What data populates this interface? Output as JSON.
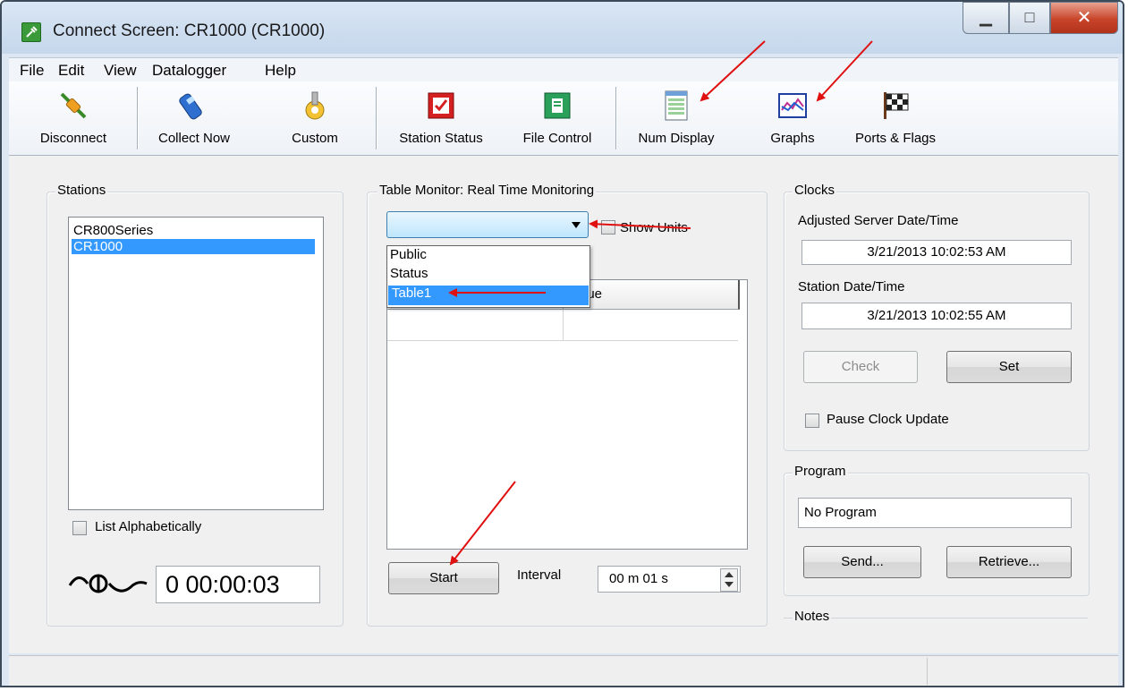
{
  "window": {
    "title": "Connect Screen: CR1000 (CR1000)"
  },
  "menu": [
    {
      "label": "File"
    },
    {
      "label": "Edit"
    },
    {
      "label": "View"
    },
    {
      "label": "Datalogger"
    },
    {
      "label": "Help"
    }
  ],
  "toolbar": {
    "disconnect": "Disconnect",
    "collect_now": "Collect Now",
    "custom": "Custom",
    "station_status": "Station Status",
    "file_control": "File Control",
    "num_display": "Num Display",
    "graphs": "Graphs",
    "ports_flags": "Ports & Flags"
  },
  "stations": {
    "label": "Stations",
    "items": [
      {
        "label": "CR800Series"
      },
      {
        "label": "CR1000"
      }
    ],
    "selected": "CR1000",
    "list_alpha": "List Alphabetically",
    "timer": "0 00:00:03"
  },
  "monitor": {
    "label": "Table Monitor: Real Time Monitoring",
    "show_units": "Show Units",
    "dropdown_options": [
      {
        "label": "Public"
      },
      {
        "label": "Status"
      },
      {
        "label": "Table1"
      }
    ],
    "highlighted_option": "Table1",
    "col_value_partial": "lue",
    "start": "Start",
    "interval_label": "Interval",
    "interval_value": "00 m 01 s"
  },
  "clocks": {
    "label": "Clocks",
    "server_label": "Adjusted Server Date/Time",
    "server_value": "3/21/2013 10:02:53 AM",
    "station_label": "Station Date/Time",
    "station_value": "3/21/2013 10:02:55 AM",
    "check": "Check",
    "set": "Set",
    "pause": "Pause Clock Update"
  },
  "program": {
    "label": "Program",
    "value": "No Program",
    "send": "Send...",
    "retrieve": "Retrieve..."
  },
  "notes": {
    "label": "Notes"
  },
  "colors": {
    "selection": "#3399ff",
    "annotation_arrow": "#e01010",
    "close_button": "#c8442a"
  }
}
